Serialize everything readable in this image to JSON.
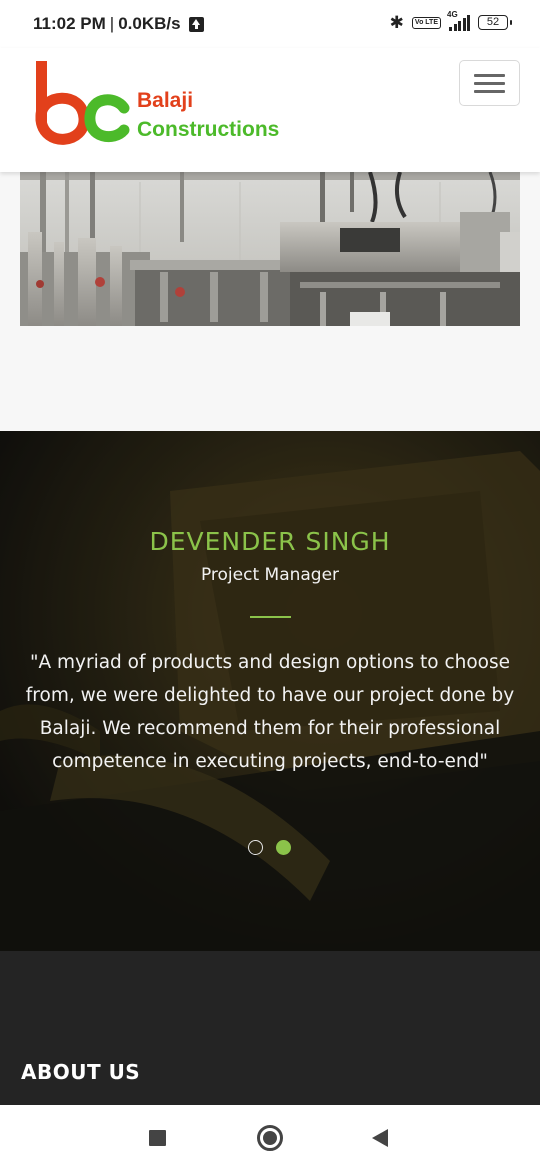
{
  "status_bar": {
    "time": "11:02 PM",
    "separator": "|",
    "speed": "0.0KB/s",
    "network": "4G",
    "volte": "Vo LTE",
    "battery": "52"
  },
  "header": {
    "logo_line1": "Balaji",
    "logo_line2": "Constructions",
    "brand_colors": {
      "red": "#e2401b",
      "green": "#4cba2a"
    }
  },
  "testimonial": {
    "name": "DEVENDER SINGH",
    "role": "Project Manager",
    "quote": "\"A myriad of products and design options to choose from, we were delighted to have our project done by Balaji. We recommend them for their professional competence in executing projects, end-to-end\"",
    "slides": 2,
    "active_slide": 2,
    "accent_color": "#8bc34a"
  },
  "footer": {
    "about_title": "ABOUT US"
  },
  "icons": {
    "upload": "upload-arrow-icon",
    "bluetooth": "bluetooth-icon",
    "signal": "signal-icon",
    "battery": "battery-icon",
    "menu": "hamburger-menu-icon",
    "nav_recent": "recent-apps-icon",
    "nav_home": "home-icon",
    "nav_back": "back-icon"
  }
}
